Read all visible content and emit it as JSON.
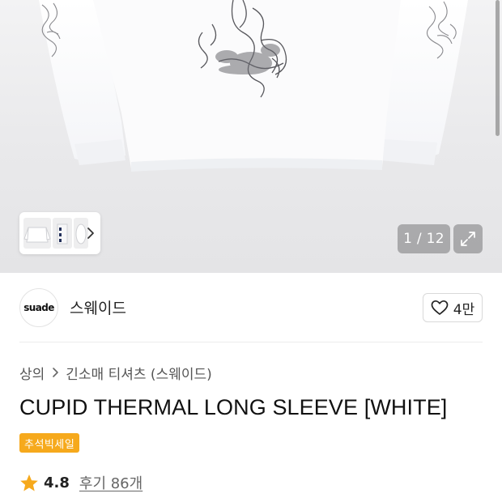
{
  "product_image": {
    "alt": "CUPID THERMAL LONG SLEEVE [WHITE]",
    "counter": "1 / 12",
    "expand_icon": "expand-icon",
    "thumbnail_arrow_icon": "chevron-right-icon"
  },
  "brand": {
    "logo_text": "suade",
    "name": "스웨이드",
    "like_icon": "heart-outline-icon",
    "like_count": "4만"
  },
  "breadcrumb": {
    "items": [
      "상의",
      "긴소매 티셔츠 (스웨이드)"
    ],
    "separator_icon": "chevron-right-icon"
  },
  "product": {
    "title": "CUPID THERMAL LONG SLEEVE [WHITE]",
    "badge": "추석빅세일",
    "badge_color": "#f6a91c",
    "rating_icon": "star-icon",
    "rating_color": "#f6a91c",
    "rating": "4.8",
    "review_label": "후기 86개"
  }
}
